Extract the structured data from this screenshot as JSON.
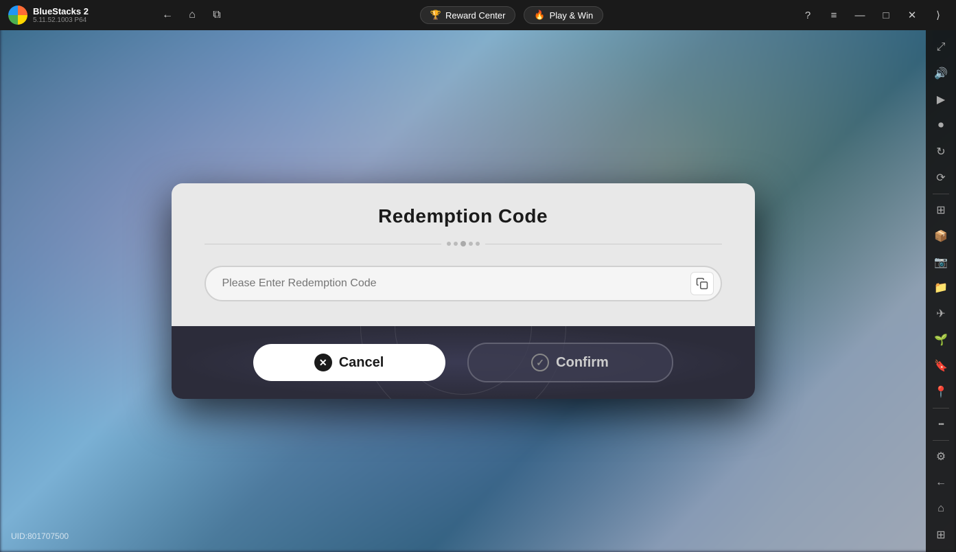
{
  "app": {
    "name": "BlueStacks 2",
    "version": "5.11.52.1003  P64"
  },
  "topbar": {
    "back_label": "←",
    "home_label": "⌂",
    "tabs_label": "⧉",
    "reward_center_label": "Reward Center",
    "play_win_label": "Play & Win",
    "help_label": "?",
    "menu_label": "≡",
    "minimize_label": "—",
    "maximize_label": "□",
    "close_label": "✕",
    "expand_label": "⟩"
  },
  "sidebar": {
    "icons": [
      {
        "name": "expand-icon",
        "glyph": "⤢"
      },
      {
        "name": "volume-icon",
        "glyph": "🔊"
      },
      {
        "name": "screen-icon",
        "glyph": "▶"
      },
      {
        "name": "record-icon",
        "glyph": "⏺"
      },
      {
        "name": "rotate-icon",
        "glyph": "↻"
      },
      {
        "name": "refresh-icon",
        "glyph": "⟳"
      },
      {
        "name": "apps-icon",
        "glyph": "⊞"
      },
      {
        "name": "package-icon",
        "glyph": "📦"
      },
      {
        "name": "screenshot-icon",
        "glyph": "📷"
      },
      {
        "name": "folder-icon",
        "glyph": "📁"
      },
      {
        "name": "airplane-icon",
        "glyph": "✈"
      },
      {
        "name": "eco-icon",
        "glyph": "🌿"
      },
      {
        "name": "bookmark-icon",
        "glyph": "🔖"
      },
      {
        "name": "location-icon",
        "glyph": "📍"
      },
      {
        "name": "more-icon",
        "glyph": "•••"
      },
      {
        "name": "settings-icon",
        "glyph": "⚙"
      },
      {
        "name": "back-sidebar-icon",
        "glyph": "←"
      },
      {
        "name": "home-sidebar-icon",
        "glyph": "⌂"
      },
      {
        "name": "grid-sidebar-icon",
        "glyph": "⊞"
      }
    ]
  },
  "dialog": {
    "title": "Redemption Code",
    "input_placeholder": "Please Enter Redemption Code",
    "cancel_label": "Cancel",
    "confirm_label": "Confirm"
  },
  "uid": {
    "text": "UID:801707500"
  }
}
